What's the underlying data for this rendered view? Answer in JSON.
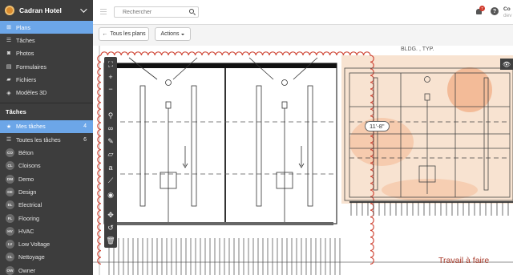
{
  "sidebar": {
    "project": "Cadran Hotel",
    "nav": [
      {
        "label": "Plans",
        "icon": "map-icon",
        "glyph": "⊞",
        "active": true
      },
      {
        "label": "Tâches",
        "icon": "list-icon",
        "glyph": "☰"
      },
      {
        "label": "Photos",
        "icon": "camera-icon",
        "glyph": "◙"
      },
      {
        "label": "Formulaires",
        "icon": "form-icon",
        "glyph": "▤"
      },
      {
        "label": "Fichiers",
        "icon": "folder-icon",
        "glyph": "▰"
      },
      {
        "label": "Modèles 3D",
        "icon": "cube-icon",
        "glyph": "◈"
      }
    ],
    "tasks_title": "Tâches",
    "tasks": [
      {
        "label": "Mes tâches",
        "icon": "star-icon",
        "glyph": "★",
        "count": "4",
        "active": true
      },
      {
        "label": "Toutes les tâches",
        "icon": "list-icon",
        "glyph": "☰",
        "count": "6"
      },
      {
        "label": "Béton",
        "badge": "CO"
      },
      {
        "label": "Cloisons",
        "badge": "CL"
      },
      {
        "label": "Demo",
        "badge": "DM"
      },
      {
        "label": "Design",
        "badge": "DE"
      },
      {
        "label": "Electrical",
        "badge": "EL"
      },
      {
        "label": "Flooring",
        "badge": "FL"
      },
      {
        "label": "HVAC",
        "badge": "HV"
      },
      {
        "label": "Low Voltage",
        "badge": "LV"
      },
      {
        "label": "Nettoyage",
        "badge": "CL"
      },
      {
        "label": "Owner",
        "badge": "OW"
      }
    ]
  },
  "topbar": {
    "search_placeholder": "Rechercher",
    "notifications": "7",
    "help": "?",
    "user_name": "Co",
    "user_sub": "dev"
  },
  "toolbar": {
    "back_label": "Tous les plans",
    "actions_label": "Actions"
  },
  "viewer": {
    "dimension_tag": "11'-8\"",
    "status_label": "Travail à faire",
    "top_note": "BLDG. , TYP.",
    "tools": [
      {
        "name": "fullscreen-icon",
        "glyph": "⛶"
      },
      {
        "name": "zoom-in-icon",
        "glyph": "+"
      },
      {
        "name": "zoom-out-icon",
        "glyph": "−"
      },
      {
        "name": "pin-icon",
        "glyph": "⚲"
      },
      {
        "name": "link-icon",
        "glyph": "∞"
      },
      {
        "name": "pen-icon",
        "glyph": "✎"
      },
      {
        "name": "shape-icon",
        "glyph": "▱"
      },
      {
        "name": "text-icon",
        "glyph": "a"
      },
      {
        "name": "ruler-icon",
        "glyph": "⟋"
      },
      {
        "name": "stamp-icon",
        "glyph": "◉"
      },
      {
        "name": "move-icon",
        "glyph": "✥"
      },
      {
        "name": "undo-icon",
        "glyph": "↺"
      },
      {
        "name": "trash-icon",
        "glyph": "🗑"
      }
    ]
  },
  "colors": {
    "sidebar_bg": "#3d3d3d",
    "active_bg": "#6ca6e8",
    "cloud_red": "#d04a3a",
    "overlay_orange": "#f2c7a6"
  }
}
